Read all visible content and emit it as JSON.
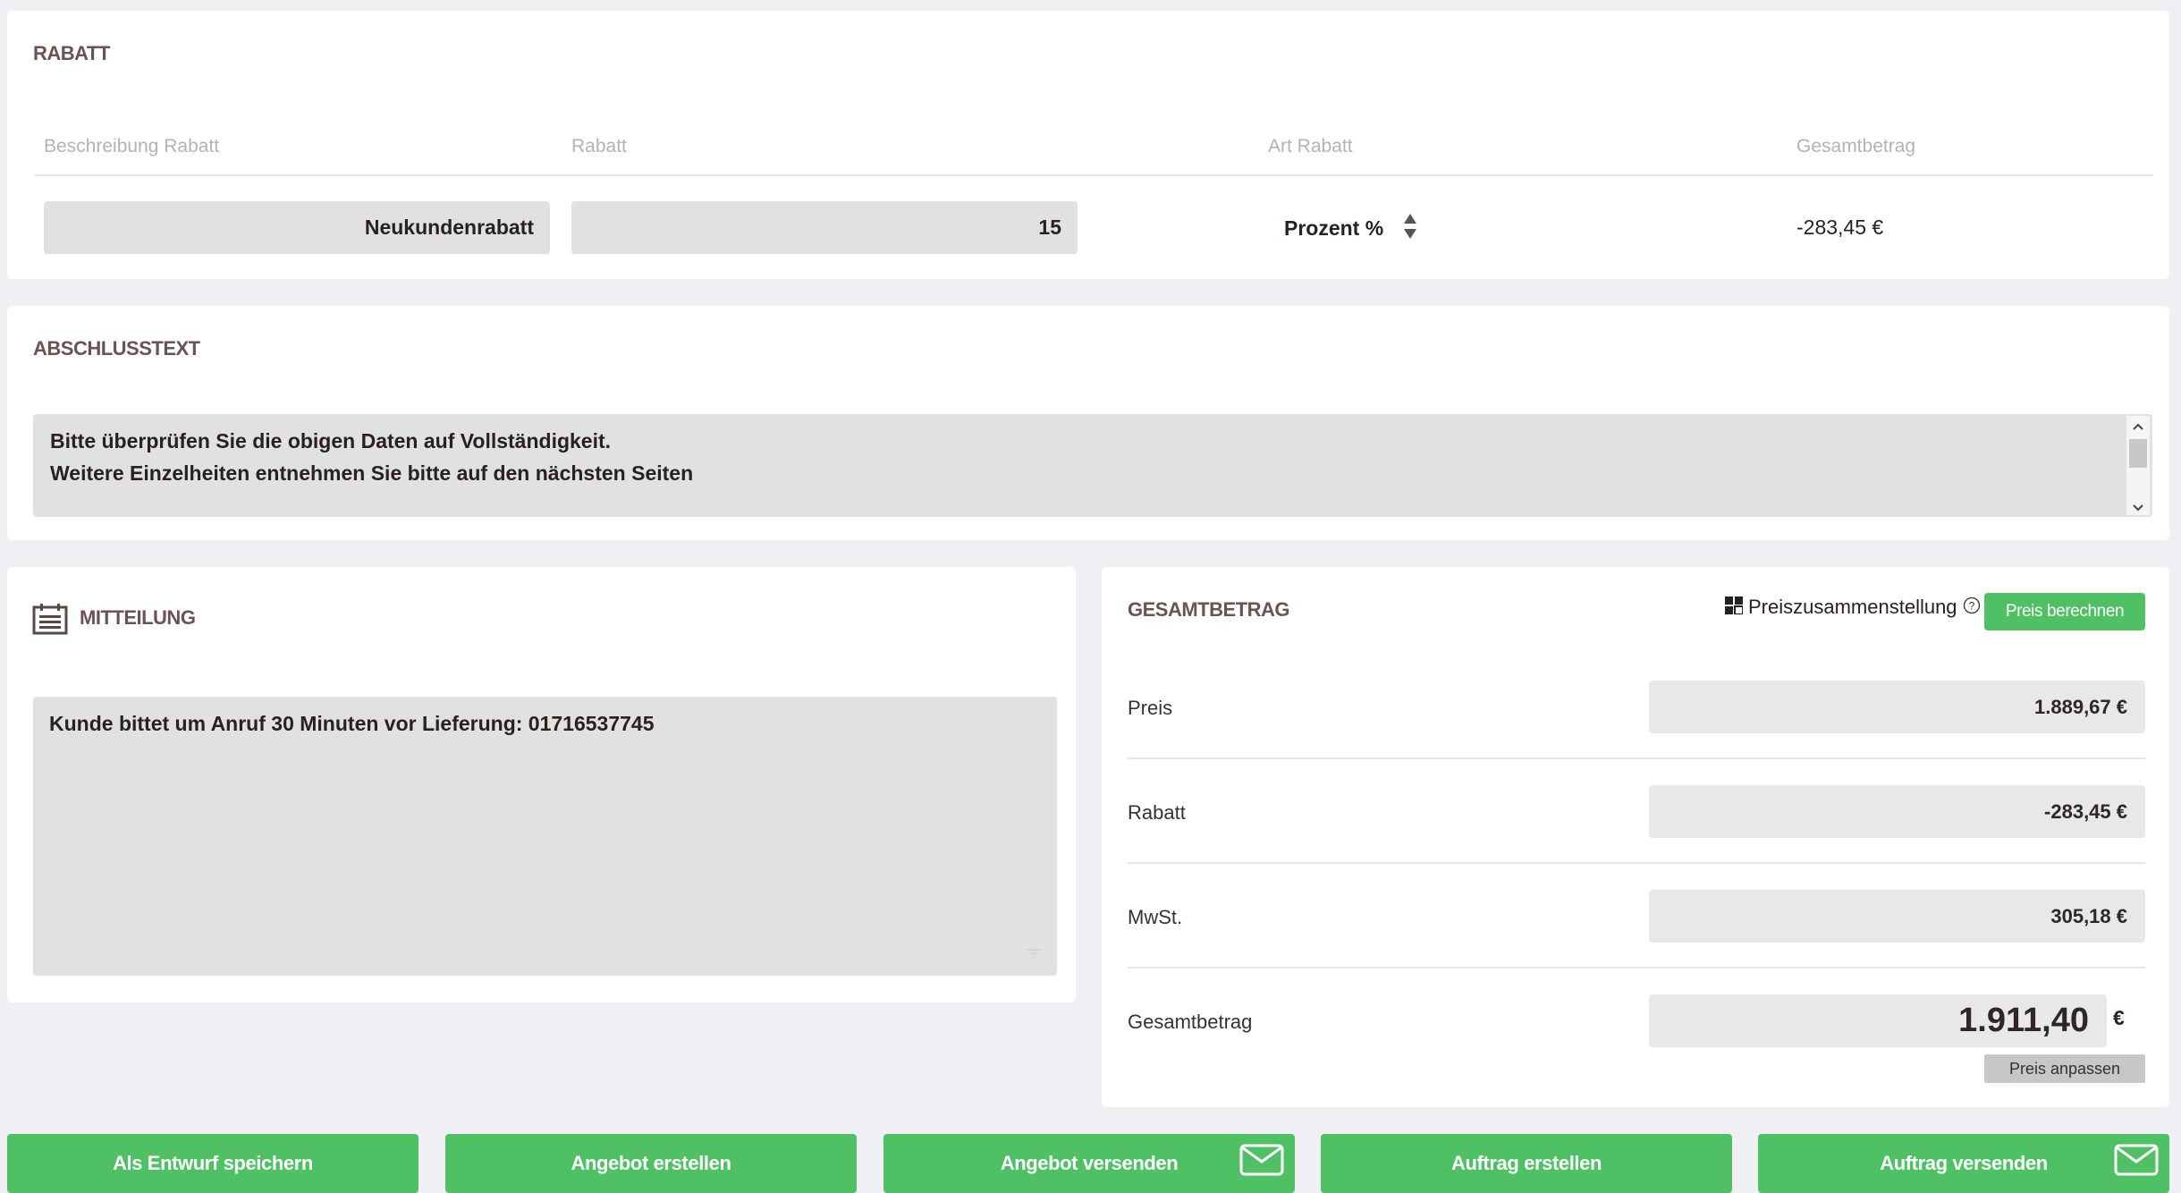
{
  "discount": {
    "title": "RABATT",
    "headers": {
      "description": "Beschreibung Rabatt",
      "discount": "Rabatt",
      "type": "Art Rabatt",
      "total": "Gesamtbetrag"
    },
    "row": {
      "description": "Neukundenrabatt",
      "discount": "15",
      "type": "Prozent %",
      "total": "-283,45 €"
    }
  },
  "closing": {
    "title": "ABSCHLUSSTEXT",
    "line1": "Bitte überprüfen Sie die obigen Daten auf Vollständigkeit.",
    "line2": "Weitere Einzelheiten entnehmen Sie bitte auf den nächsten Seiten"
  },
  "message": {
    "title": "MITTEILUNG",
    "text": "Kunde bittet um Anruf 30 Minuten vor Lieferung: 01716537745"
  },
  "summary": {
    "title": "GESAMTBETRAG",
    "composition_label": "Preiszusammenstellung",
    "calc_button": "Preis berechnen",
    "rows": [
      {
        "label": "Preis",
        "value": "1.889,67 €"
      },
      {
        "label": "Rabatt",
        "value": "-283,45 €"
      },
      {
        "label": "MwSt.",
        "value": "305,18 €"
      }
    ],
    "total_label": "Gesamtbetrag",
    "total_value": "1.911,40",
    "currency": "€",
    "adjust_button": "Preis anpassen"
  },
  "actions": {
    "save_draft": "Als Entwurf speichern",
    "create_offer": "Angebot erstellen",
    "send_offer": "Angebot versenden",
    "create_order": "Auftrag erstellen",
    "send_order": "Auftrag versenden"
  },
  "colors": {
    "accent_green": "#4fc064",
    "title_brown": "#6b5253",
    "background": "#eff0f3"
  }
}
